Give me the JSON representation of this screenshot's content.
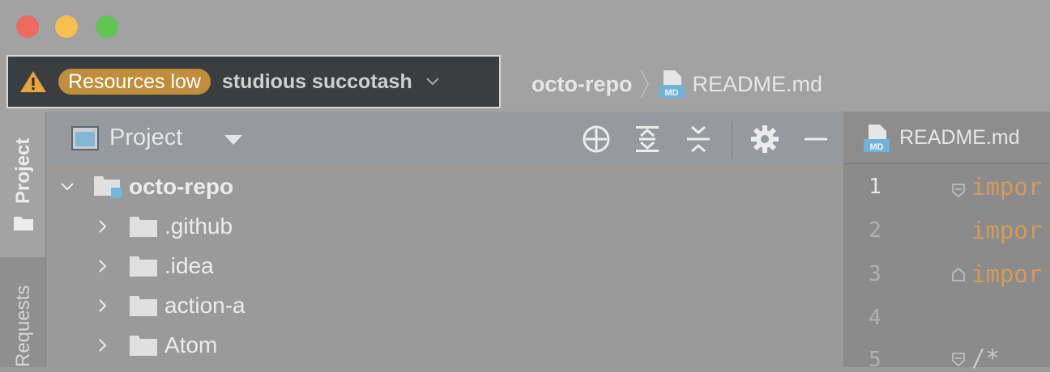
{
  "window": {
    "traffic_lights": {
      "close_color": "#ed6a5e",
      "minimize_color": "#f5c04f",
      "zoom_color": "#61c454"
    }
  },
  "project_widget": {
    "warning_icon": "warning-triangle-icon",
    "badge": "Resources low",
    "badge_color": "#c08e3a",
    "project_name": "studious succotash",
    "dropdown_icon": "chevron-down-icon"
  },
  "breadcrumb": {
    "root": "octo-repo",
    "file": "README.md",
    "file_icon": "markdown-file-icon"
  },
  "sidebar": {
    "tabs": [
      {
        "label": "Project",
        "icon": "folder-icon"
      },
      {
        "label": "Requests"
      }
    ]
  },
  "project_panel": {
    "title": "Project",
    "tools": [
      "locate-crosshair-icon",
      "expand-all-icon",
      "collapse-all-icon",
      "gear-icon",
      "minimize-icon"
    ],
    "tree": [
      {
        "name": "octo-repo",
        "expanded": true,
        "root": true
      },
      {
        "name": ".github",
        "expanded": false
      },
      {
        "name": ".idea",
        "expanded": false
      },
      {
        "name": "action-a",
        "expanded": false
      },
      {
        "name": "Atom",
        "expanded": false
      }
    ]
  },
  "editor": {
    "tab": {
      "label": "README.md",
      "icon": "markdown-file-icon"
    },
    "lines": [
      {
        "number": "1",
        "text": "impor"
      },
      {
        "number": "2",
        "text": "impor"
      },
      {
        "number": "3",
        "text": "impor"
      },
      {
        "number": "4",
        "text": ""
      },
      {
        "number": "5",
        "text": "/*"
      }
    ]
  }
}
